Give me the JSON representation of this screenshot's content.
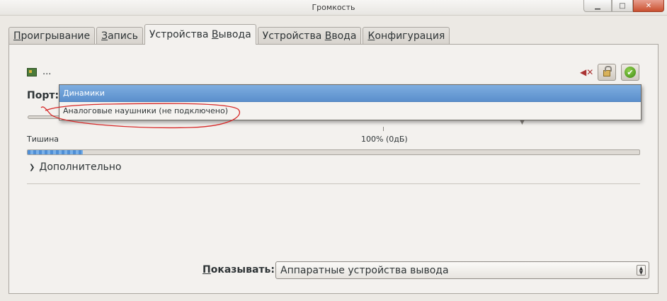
{
  "window": {
    "title": "Громкость",
    "minimize_icon": "minimize-icon",
    "maximize_icon": "maximize-icon",
    "close_icon": "close-icon"
  },
  "tabs": [
    {
      "label": "Проигрывание",
      "mnemonic_index": 0
    },
    {
      "label": "Запись",
      "mnemonic_index": 0
    },
    {
      "label": "Устройства Вывода",
      "mnemonic_index": 11
    },
    {
      "label": "Устройства Ввода",
      "mnemonic_index": 11
    },
    {
      "label": "Конфигурация",
      "mnemonic_index": 0
    }
  ],
  "active_tab": 2,
  "device": {
    "name": "...",
    "icon": "sound-card-icon",
    "mute_icon": "mute-icon",
    "lock_icon": "lock-icon",
    "default_icon": "checkmark-icon"
  },
  "port": {
    "label": "Порт:",
    "options": [
      "Динамики",
      "Аналоговые наушники (не подключено)"
    ],
    "selected_index": 0
  },
  "volume": {
    "min_label": "Тишина",
    "mark_label": "100% (0дБ)",
    "peak_level_fraction": 0.09
  },
  "advanced": {
    "label": "Дополнительно",
    "icon": "chevron-right-icon"
  },
  "show": {
    "label": "Показывать:",
    "mnemonic_index": 0,
    "value": "Аппаратные устройства вывода",
    "icon": "spinner-arrows-icon"
  },
  "annotation_color": "#d62828"
}
